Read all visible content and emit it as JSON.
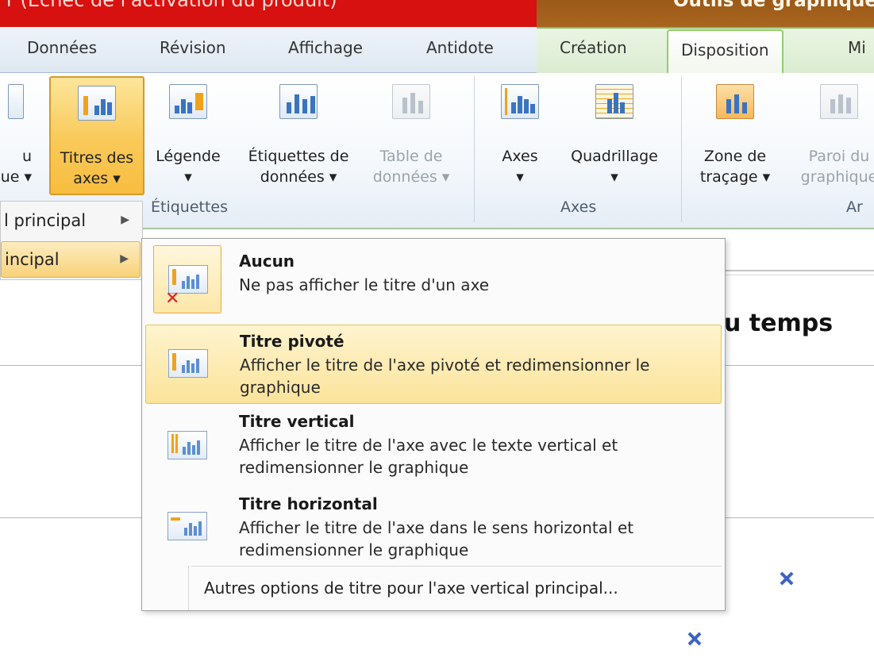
{
  "window": {
    "title": "r (Échec de l'activation du produit)",
    "context_tools": "Outils de graphique"
  },
  "tabs": [
    {
      "label": "Données"
    },
    {
      "label": "Révision"
    },
    {
      "label": "Affichage"
    },
    {
      "label": "Antidote"
    },
    {
      "label": "Création"
    },
    {
      "label": "Disposition",
      "active": true
    },
    {
      "label": "Mi"
    }
  ],
  "ribbon": {
    "buttons": {
      "partial_left": [
        "u",
        "ue ▾"
      ],
      "axis_titles": [
        "Titres des",
        "axes ▾"
      ],
      "legend": [
        "Légende",
        "▾"
      ],
      "data_labels": [
        "Étiquettes de",
        "données ▾"
      ],
      "data_table": [
        "Table de",
        "données ▾"
      ],
      "axes": [
        "Axes",
        "▾"
      ],
      "gridlines": [
        "Quadrillage",
        "▾"
      ],
      "plot_area": [
        "Zone de",
        "traçage ▾"
      ],
      "chart_wall": [
        "Paroi du",
        "graphique"
      ]
    },
    "groups": {
      "labels": "Étiquettes",
      "axes": "Axes",
      "background": "Ar"
    }
  },
  "submenu": {
    "items": [
      {
        "label": "l principal",
        "arrow": "▶"
      },
      {
        "label": "incipal",
        "arrow": "▶"
      }
    ]
  },
  "dropdown": {
    "options": [
      {
        "title": "Aucun",
        "desc": "Ne pas afficher le titre d'un axe"
      },
      {
        "title": "Titre pivoté",
        "desc": "Afficher le titre de l'axe pivoté et redimensionner le graphique"
      },
      {
        "title": "Titre vertical",
        "desc": "Afficher le titre de l'axe avec le texte vertical et redimensionner le graphique"
      },
      {
        "title": "Titre horizontal",
        "desc": "Afficher le titre de l'axe dans le sens horizontal et redimensionner le graphique"
      }
    ],
    "more_options": "Autres options de titre pour l'axe vertical principal..."
  },
  "slide": {
    "title_fragment": "u temps"
  },
  "colors": {
    "title_red": "#d7110f",
    "context_brown": "#a86520",
    "context_green": "#8fcf6a",
    "highlight_gold": "#f9c958",
    "series_blue": "#3d63c4"
  }
}
